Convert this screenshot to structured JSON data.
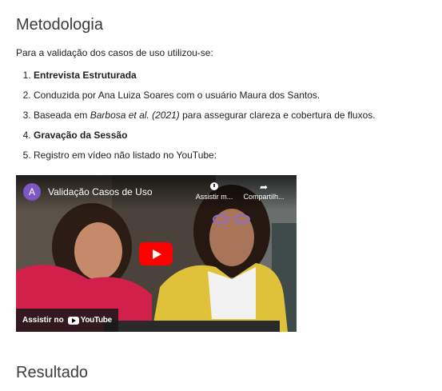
{
  "headings": {
    "metodologia": "Metodologia",
    "resultado": "Resultado"
  },
  "intro": "Para a validação dos casos de uso utilizou-se:",
  "list": {
    "item1": "Entrevista Estruturada",
    "item2": "Conduzida por Ana Luiza Soares com o usuário Maura dos Santos.",
    "item3_before": "Baseada em ",
    "item3_italic": "Barbosa et al. (2021)",
    "item3_after": " para assegurar clareza e cobertura de fluxos.",
    "item4": "Gravação da Sessão",
    "item5": "Registro em vídeo não listado no YouTube:"
  },
  "video": {
    "channel_initial": "A",
    "title": "Validação Casos de Uso",
    "watch_later_label": "Assistir m...",
    "share_label": "Compartilh...",
    "watch_on_label": "Assistir no",
    "youtube_word": "YouTube",
    "icons": [
      "clock-icon",
      "share-arrow-icon",
      "play-icon",
      "youtube-logo-icon"
    ],
    "colors": {
      "play": "#ff0000",
      "avatar": "#7e57c2"
    }
  }
}
